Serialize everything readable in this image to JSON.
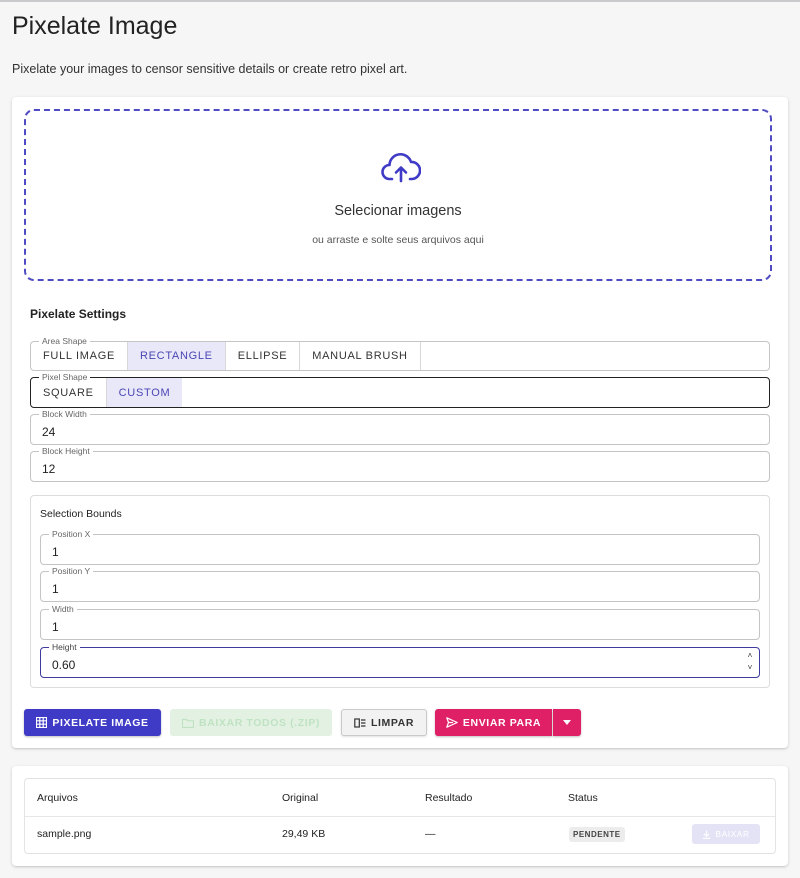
{
  "page": {
    "title": "Pixelate Image",
    "subtitle": "Pixelate your images to censor sensitive details or create retro pixel art."
  },
  "dropzone": {
    "icon": "cloud-upload-icon",
    "title": "Selecionar imagens",
    "subtitle": "ou arraste e solte seus arquivos aqui"
  },
  "settings": {
    "title": "Pixelate Settings",
    "area_shape": {
      "label": "Area Shape",
      "options": [
        "FULL IMAGE",
        "RECTANGLE",
        "ELLIPSE",
        "MANUAL BRUSH"
      ],
      "selected": "RECTANGLE"
    },
    "pixel_shape": {
      "label": "Pixel Shape",
      "options": [
        "SQUARE",
        "CUSTOM"
      ],
      "selected": "CUSTOM"
    },
    "block_width": {
      "label": "Block Width",
      "value": "24"
    },
    "block_height": {
      "label": "Block Height",
      "value": "12"
    }
  },
  "bounds": {
    "title": "Selection Bounds",
    "position_x": {
      "label": "Position X",
      "value": "1"
    },
    "position_y": {
      "label": "Position Y",
      "value": "1"
    },
    "width": {
      "label": "Width",
      "value": "1"
    },
    "height": {
      "label": "Height",
      "value": "0.60"
    }
  },
  "actions": {
    "pixelate": "PIXELATE IMAGE",
    "download_all": "BAIXAR TODOS (.ZIP)",
    "clear": "LIMPAR",
    "send_to": "ENVIAR PARA"
  },
  "files_table": {
    "headers": [
      "Arquivos",
      "Original",
      "Resultado",
      "Status"
    ],
    "rows": [
      {
        "name": "sample.png",
        "original": "29,49 KB",
        "result": "—",
        "status": "PENDENTE",
        "action": "BAIXAR"
      }
    ]
  },
  "colors": {
    "accent": "#3f3bc7",
    "pink": "#df1f66",
    "selected_bg": "#e9e8f8"
  }
}
